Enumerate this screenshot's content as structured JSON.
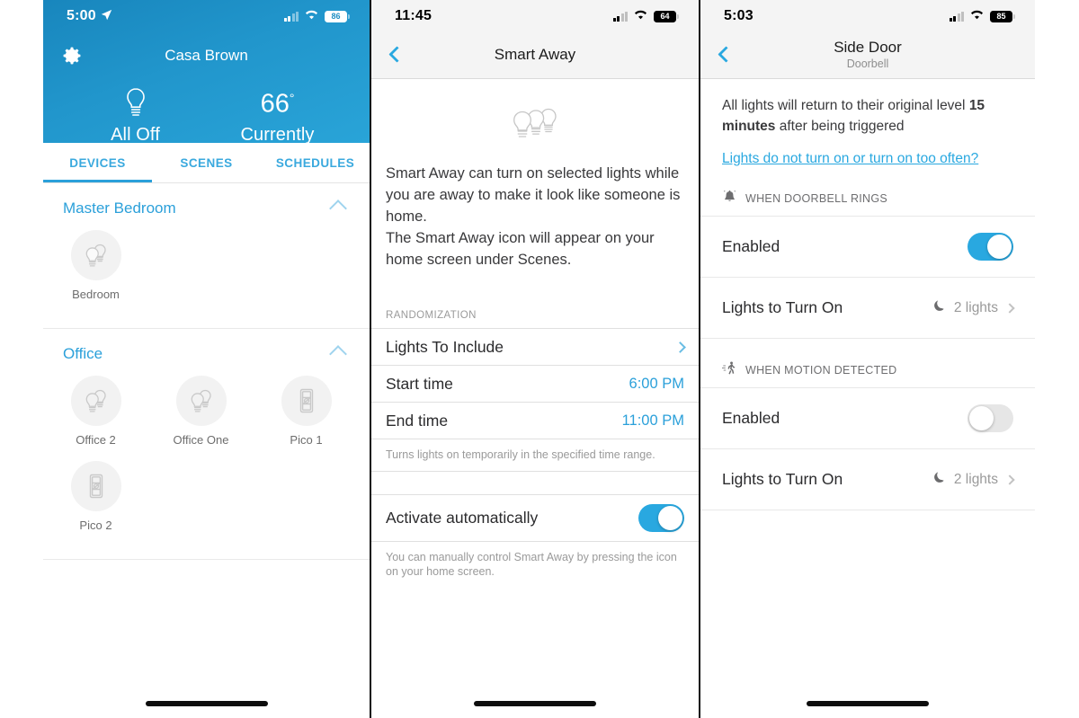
{
  "panel1": {
    "status": {
      "time": "5:00",
      "battery": "86",
      "location_icon": "location-arrow-icon",
      "wifi_icon": "wifi-icon",
      "cell_icon": "cellular-bars-icon"
    },
    "header": {
      "gear_icon": "gear-icon",
      "title": "Casa Brown",
      "actions": [
        {
          "icon": "lightbulb-icon",
          "label": "All Off"
        },
        {
          "value": "66",
          "degree": "°",
          "label": "Currently"
        }
      ]
    },
    "tabs": [
      {
        "label": "DEVICES",
        "active": true
      },
      {
        "label": "SCENES",
        "active": false
      },
      {
        "label": "SCHEDULES",
        "active": false
      }
    ],
    "groups": [
      {
        "name": "Master Bedroom",
        "collapse_icon": "chevron-up-icon",
        "devices": [
          {
            "name": "Bedroom",
            "icon": "double-bulb-icon"
          }
        ]
      },
      {
        "name": "Office",
        "collapse_icon": "chevron-up-icon",
        "devices": [
          {
            "name": "Office 2",
            "icon": "double-bulb-icon"
          },
          {
            "name": "Office One",
            "icon": "double-bulb-icon"
          },
          {
            "name": "Pico 1",
            "icon": "pico-remote-icon"
          },
          {
            "name": "Pico 2",
            "icon": "pico-remote-icon"
          }
        ]
      }
    ]
  },
  "panel2": {
    "status": {
      "time": "11:45",
      "battery": "64"
    },
    "nav": {
      "back_icon": "back-chevron-icon",
      "title": "Smart Away"
    },
    "hero_icon": "three-bulbs-icon",
    "description": "Smart Away can turn on selected lights while you are away to make it look like someone is home.\nThe Smart Away icon will appear on your home screen under Scenes.",
    "section_label": "RANDOMIZATION",
    "rows": [
      {
        "label": "Lights To Include",
        "value": "",
        "accessory": "chevron-right-icon"
      },
      {
        "label": "Start time",
        "value": "6:00 PM",
        "accessory": ""
      },
      {
        "label": "End time",
        "value": "11:00 PM",
        "accessory": ""
      }
    ],
    "note1": "Turns lights on temporarily in the specified time range.",
    "toggle_row": {
      "label": "Activate automatically",
      "state": "on"
    },
    "note2": "You can manually control Smart Away by pressing the icon on your home screen."
  },
  "panel3": {
    "status": {
      "time": "5:03",
      "battery": "85"
    },
    "nav": {
      "back_icon": "back-chevron-icon",
      "title": "Side Door",
      "subtitle": "Doorbell"
    },
    "note_pre": "All lights will return to their original level ",
    "note_bold": "15 minutes",
    "note_post": " after being triggered",
    "link": "Lights do not turn on or turn on too often?",
    "sections": [
      {
        "icon": "doorbell-ringing-icon",
        "title": "WHEN DOORBELL RINGS",
        "rows": [
          {
            "label": "Enabled",
            "type": "toggle",
            "state": "on"
          },
          {
            "label": "Lights to Turn On",
            "type": "value",
            "icon": "moon-icon",
            "value": "2 lights",
            "accessory": "chevron-right-icon"
          }
        ]
      },
      {
        "icon": "motion-walking-icon",
        "title": "WHEN MOTION DETECTED",
        "rows": [
          {
            "label": "Enabled",
            "type": "toggle",
            "state": "off"
          },
          {
            "label": "Lights to Turn On",
            "type": "value",
            "icon": "moon-icon",
            "value": "2 lights",
            "accessory": "chevron-right-icon"
          }
        ]
      }
    ]
  },
  "colors": {
    "accent": "#29a8e0",
    "hero_from": "#1886bd",
    "hero_to": "#29a4d8",
    "toggle_on": "#29a8e0",
    "toggle_off": "#e6e6e6"
  }
}
